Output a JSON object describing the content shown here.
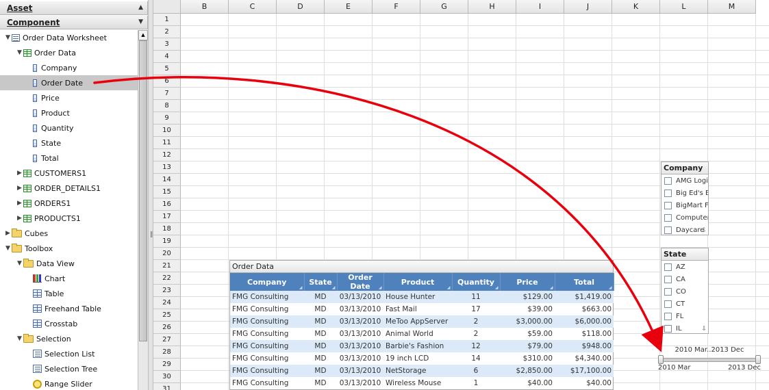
{
  "asset_header": {
    "label": "Asset"
  },
  "component_header": {
    "label": "Component"
  },
  "tree": {
    "worksheet": "Order Data Worksheet",
    "order_data": "Order Data",
    "columns": [
      "Company",
      "Order Date",
      "Price",
      "Product",
      "Quantity",
      "State",
      "Total"
    ],
    "selected_column": "Order Date",
    "tables": [
      "CUSTOMERS1",
      "ORDER_DETAILS1",
      "ORDERS1",
      "PRODUCTS1"
    ],
    "cubes": "Cubes",
    "toolbox": "Toolbox",
    "data_view": "Data View",
    "data_view_items": [
      {
        "label": "Chart",
        "icon": "chart-icon"
      },
      {
        "label": "Table",
        "icon": "table-icon"
      },
      {
        "label": "Freehand Table",
        "icon": "freehand-table-icon"
      },
      {
        "label": "Crosstab",
        "icon": "crosstab-icon"
      }
    ],
    "selection": "Selection",
    "selection_items": [
      {
        "label": "Selection List",
        "icon": "selection-list-icon"
      },
      {
        "label": "Selection Tree",
        "icon": "selection-tree-icon"
      },
      {
        "label": "Range Slider",
        "icon": "range-slider-icon"
      }
    ]
  },
  "sheet": {
    "columns": [
      "B",
      "C",
      "D",
      "E",
      "F",
      "G",
      "H",
      "I",
      "J",
      "K",
      "L",
      "M"
    ],
    "rows": [
      "1",
      "2",
      "3",
      "4",
      "5",
      "6",
      "7",
      "8",
      "9",
      "10",
      "11",
      "12",
      "13",
      "14",
      "15",
      "16",
      "17",
      "18",
      "19",
      "20",
      "21",
      "22",
      "23",
      "24",
      "25",
      "26",
      "27",
      "28",
      "29",
      "30",
      "31"
    ]
  },
  "order_table": {
    "title": "Order Data",
    "headers": [
      "Company",
      "State",
      "Order Date",
      "Product",
      "Quantity",
      "Price",
      "Total"
    ],
    "rows": [
      [
        "FMG Consulting",
        "MD",
        "03/13/2010",
        "House Hunter",
        "11",
        "$129.00",
        "$1,419.00"
      ],
      [
        "FMG Consulting",
        "MD",
        "03/13/2010",
        "Fast Mail",
        "17",
        "$39.00",
        "$663.00"
      ],
      [
        "FMG Consulting",
        "MD",
        "03/13/2010",
        "MeToo AppServer",
        "2",
        "$3,000.00",
        "$6,000.00"
      ],
      [
        "FMG Consulting",
        "MD",
        "03/13/2010",
        "Animal World",
        "2",
        "$59.00",
        "$118.00"
      ],
      [
        "FMG Consulting",
        "MD",
        "03/13/2010",
        "Barbie's Fashion",
        "12",
        "$79.00",
        "$948.00"
      ],
      [
        "FMG Consulting",
        "MD",
        "03/13/2010",
        "19 inch LCD",
        "14",
        "$310.00",
        "$4,340.00"
      ],
      [
        "FMG Consulting",
        "MD",
        "03/13/2010",
        "NetStorage",
        "6",
        "$2,850.00",
        "$17,100.00"
      ],
      [
        "FMG Consulting",
        "MD",
        "03/13/2010",
        "Wireless Mouse",
        "1",
        "$40.00",
        "$40.00"
      ]
    ]
  },
  "company_list": {
    "title": "Company",
    "options": [
      "AMG Logi",
      "Big Ed's B",
      "BigMart F",
      "Computer",
      "Daycare"
    ]
  },
  "state_list": {
    "title": "State",
    "options": [
      "AZ",
      "CA",
      "CO",
      "CT",
      "FL",
      "IL"
    ]
  },
  "range_slider": {
    "range_label": "2010 Mar..2013 Dec",
    "min_label": "2010 Mar",
    "max_label": "2013 Dec"
  },
  "colors": {
    "table_header": "#4f81bd",
    "table_alt_row": "#dce9f8",
    "arrow": "#e8000d",
    "selected_tree_item": "#c8c8c8"
  }
}
